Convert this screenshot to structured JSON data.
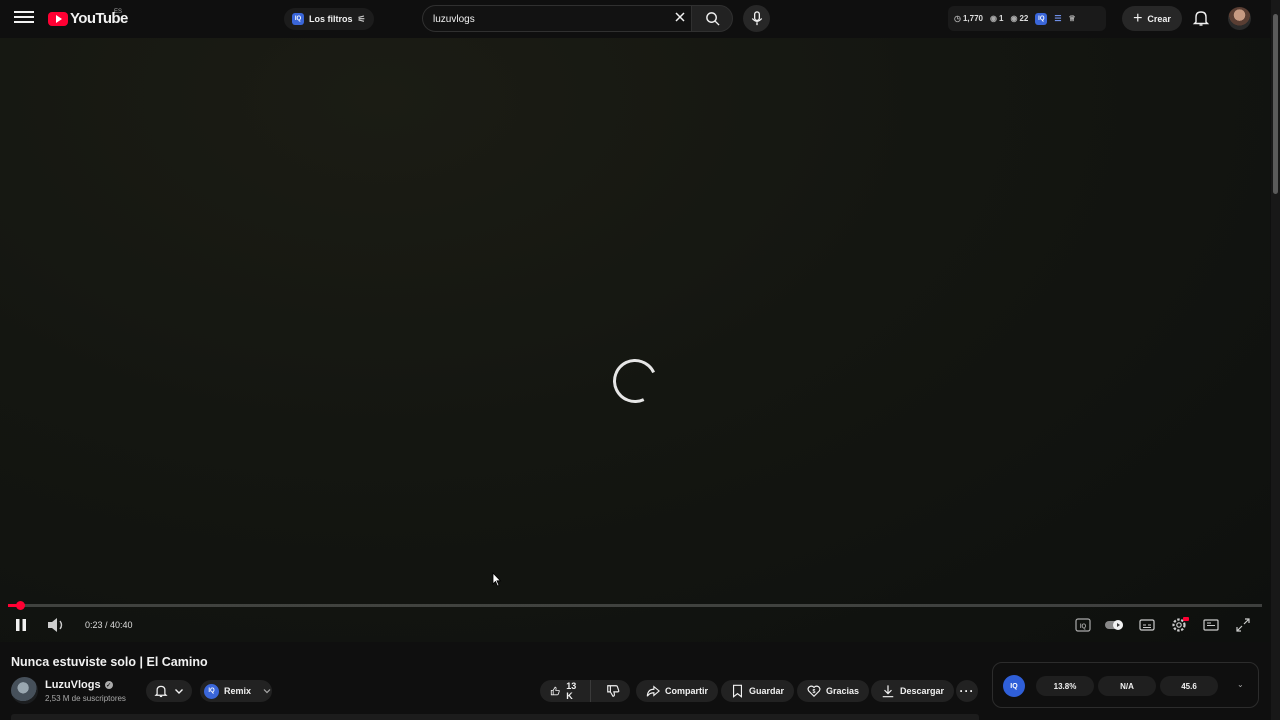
{
  "header": {
    "logo_text": "YouTube",
    "logo_region": "ES",
    "filters_label": "Los filtros",
    "search": {
      "value": "luzuvlogs",
      "placeholder": "Buscar"
    },
    "stats": {
      "watch_count": "1,770",
      "views_a": "1",
      "views_b": "22"
    },
    "create_label": "Crear"
  },
  "player": {
    "time_current": "0:23",
    "time_total": "40:40",
    "time_display": "0:23 / 40:40",
    "progress_fraction": 0.0094,
    "state": "loading"
  },
  "video": {
    "title": "Nunca estuviste solo | El Camino",
    "channel_name": "LuzuVlogs",
    "subscribers": "2,53 M de suscriptores",
    "remix_label": "Remix",
    "like_count": "13 K",
    "share_label": "Compartir",
    "save_label": "Guardar",
    "thanks_label": "Gracias",
    "download_label": "Descargar"
  },
  "iq_panel": {
    "badge": "IQ",
    "metric_1": "13.8%",
    "metric_2": "N/A",
    "metric_3": "45.6"
  },
  "colors": {
    "accent": "#ff0033",
    "iq_blue": "#3a66d9",
    "background": "#0f0f0f"
  }
}
